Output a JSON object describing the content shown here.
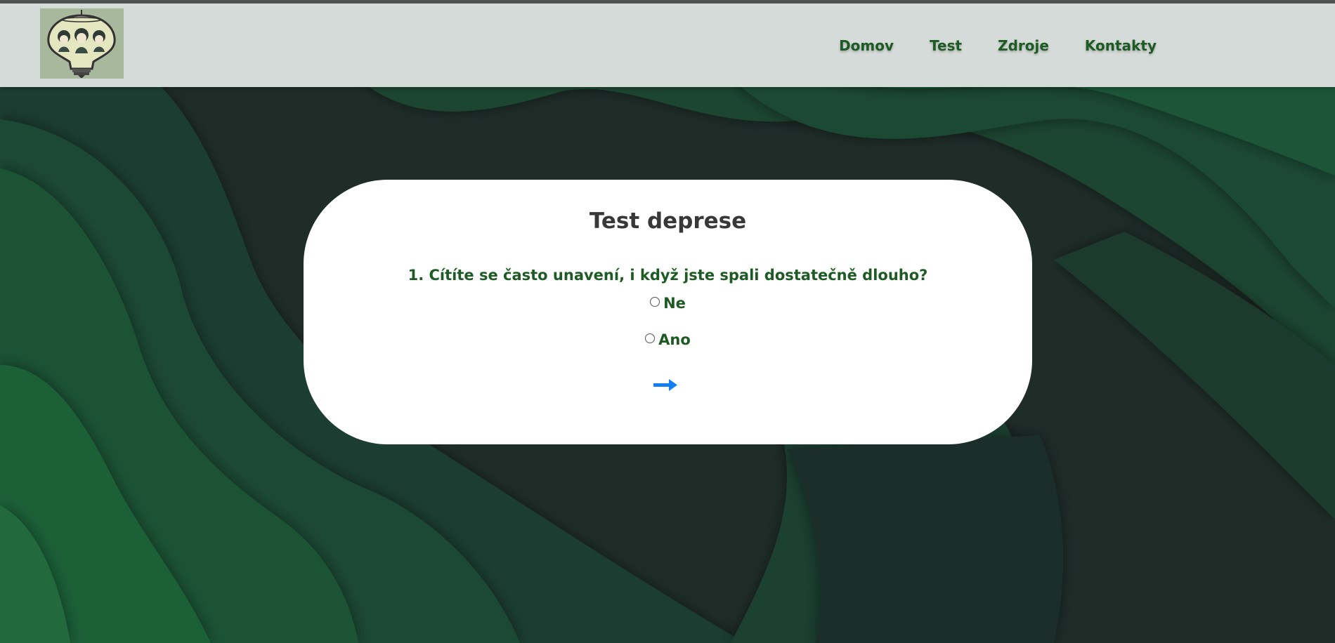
{
  "nav": {
    "links": [
      "Domov",
      "Test",
      "Zdroje",
      "Kontakty"
    ]
  },
  "test": {
    "title": "Test deprese",
    "question": "1. Cítíte se často unavení, i když jste spali dostatečně dlouho?",
    "options": [
      "Ne",
      "Ano"
    ],
    "next_icon": "arrow-right-icon"
  },
  "colors": {
    "accent_green": "#1e5a24",
    "title_gray": "#383838",
    "arrow_blue": "#1580f5",
    "navbar_bg": "#d5dbd8",
    "background_dark": "#1f2e29",
    "background_green": "#1e6b3b"
  }
}
